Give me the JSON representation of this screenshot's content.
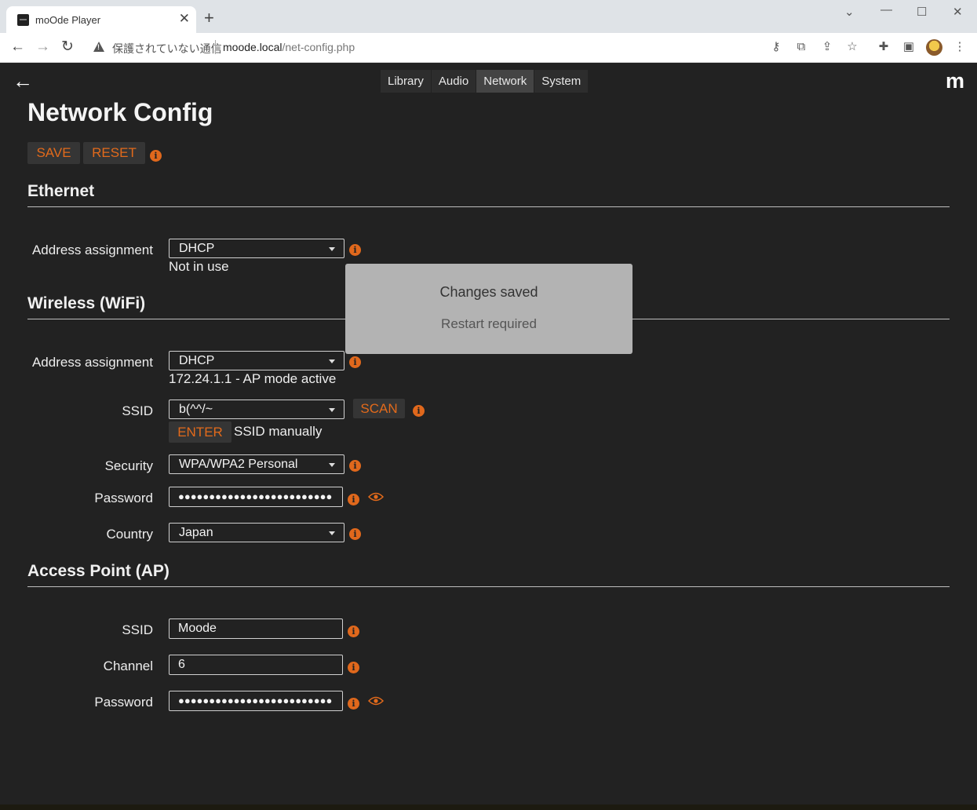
{
  "browser": {
    "tab_title": "moOde Player",
    "tab_close": "✕",
    "new_tab": "+",
    "security_text": "保護されていない通信",
    "url_host": "moode.local",
    "url_path": "/net-config.php"
  },
  "nav": {
    "tabs": [
      "Library",
      "Audio",
      "Network",
      "System"
    ],
    "active_tab": "Network",
    "logo": "m"
  },
  "page": {
    "title": "Network Config",
    "save_label": "SAVE",
    "reset_label": "RESET"
  },
  "ethernet": {
    "title": "Ethernet",
    "address_label": "Address assignment",
    "address_value": "DHCP",
    "status": "Not in use"
  },
  "wifi": {
    "title": "Wireless (WiFi)",
    "address_label": "Address assignment",
    "address_value": "DHCP",
    "status": "172.24.1.1 - AP mode active",
    "ssid_label": "SSID",
    "ssid_value": "b(^^/~",
    "scan_label": "SCAN",
    "enter_label": "ENTER",
    "enter_suffix": "SSID manually",
    "security_label": "Security",
    "security_value": "WPA/WPA2 Personal",
    "password_label": "Password",
    "password_value": "●●●●●●●●●●●●●●●●●●●●●●●●●",
    "country_label": "Country",
    "country_value": "Japan"
  },
  "ap": {
    "title": "Access Point (AP)",
    "ssid_label": "SSID",
    "ssid_value": "Moode",
    "channel_label": "Channel",
    "channel_value": "6",
    "password_label": "Password",
    "password_value": "●●●●●●●●●●●●●●●●●●●●●●●●●"
  },
  "modal": {
    "title": "Changes saved",
    "message": "Restart required"
  },
  "colors": {
    "accent": "#e26a1b",
    "background": "#222222",
    "modal_bg": "#b3b3b3"
  }
}
